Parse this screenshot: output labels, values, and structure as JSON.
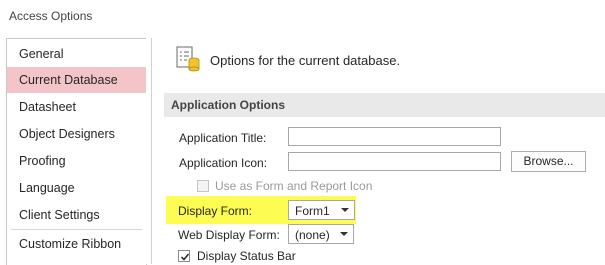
{
  "window": {
    "title": "Access Options"
  },
  "sidebar": {
    "items": [
      {
        "label": "General"
      },
      {
        "label": "Current Database",
        "active": true
      },
      {
        "label": "Datasheet"
      },
      {
        "label": "Object Designers"
      },
      {
        "label": "Proofing"
      },
      {
        "label": "Language"
      },
      {
        "label": "Client Settings"
      },
      {
        "label": "Customize Ribbon"
      }
    ]
  },
  "header": {
    "text": "Options for the current database.",
    "icon": "options-list-database-icon"
  },
  "section": {
    "title": "Application Options"
  },
  "fields": {
    "app_title": {
      "label": "Application Title:",
      "value": ""
    },
    "app_icon": {
      "label": "Application Icon:",
      "value": "",
      "browse_label": "Browse..."
    },
    "use_as_icon": {
      "label": "Use as Form and Report Icon",
      "checked": false,
      "enabled": false
    },
    "display_form": {
      "label": "Display Form:",
      "value": "Form1"
    },
    "web_display_form": {
      "label": "Web Display Form:",
      "value": "(none)"
    },
    "display_status_bar": {
      "label": "Display Status Bar",
      "checked": true
    }
  },
  "colors": {
    "active_sidebar": "#f3c5c9",
    "highlight": "#fcfc52",
    "section_band": "#e9e9e9"
  }
}
